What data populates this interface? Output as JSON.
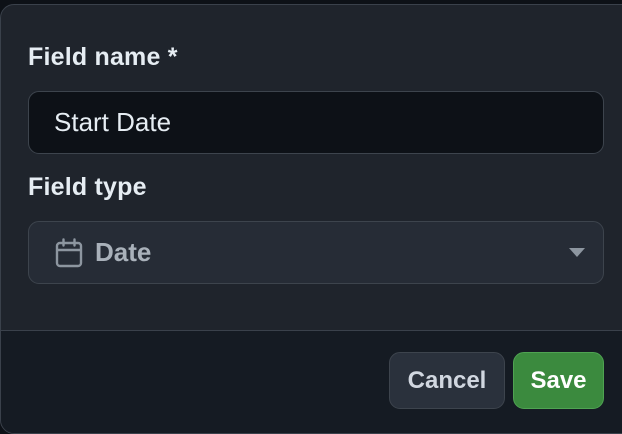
{
  "form": {
    "field_name_label": "Field name *",
    "field_name_value": "Start Date",
    "field_type_label": "Field type",
    "field_type_value": "Date",
    "field_type_icon": "calendar-icon",
    "dropdown_icon": "triangle-down-icon"
  },
  "footer": {
    "cancel_label": "Cancel",
    "save_label": "Save"
  },
  "colors": {
    "dialog_bg": "#1f242c",
    "input_bg": "#0d1117",
    "save_button": "#3b8a3e",
    "text": "#e6edf3"
  }
}
